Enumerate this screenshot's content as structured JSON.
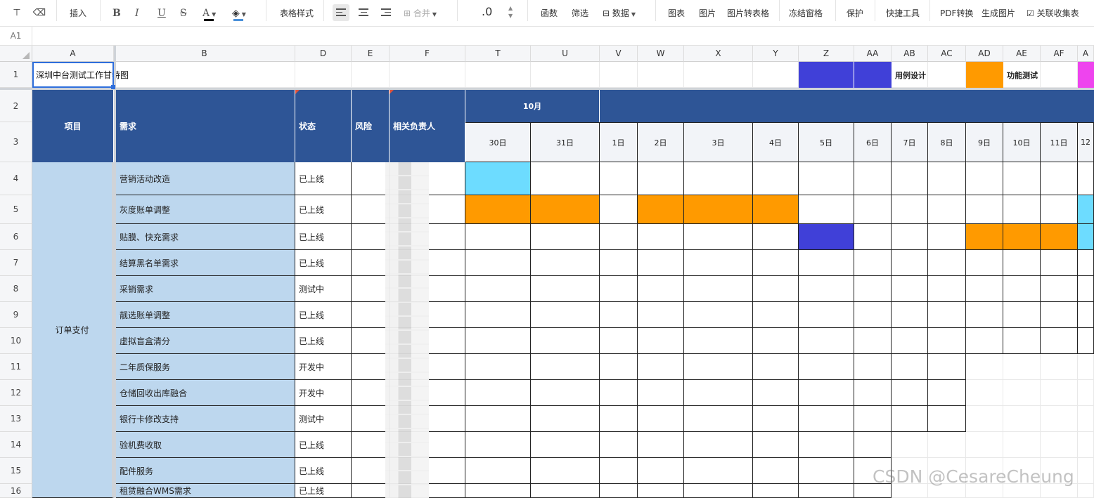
{
  "toolbar": {
    "insert": "插入",
    "table_style": "表格样式",
    "merge": "合并",
    "decimal": ".0",
    "function": "函数",
    "filter": "筛选",
    "data": "数据",
    "chart": "图表",
    "image": "图片",
    "image_to_table": "图片转表格",
    "freeze": "冻结窗格",
    "protect": "保护",
    "quick_tools": "快捷工具",
    "pdf_convert": "PDF转换",
    "generate_image": "生成图片",
    "linked_form": "关联收集表",
    "font_color": "#000000",
    "fill_color": "#4a90d9"
  },
  "formula": {
    "cell_ref": "A1"
  },
  "columns": [
    "A",
    "B",
    "D",
    "E",
    "F",
    "T",
    "U",
    "V",
    "W",
    "X",
    "Y",
    "Z",
    "AA",
    "AB",
    "AC",
    "AD",
    "AE",
    "AF",
    "A"
  ],
  "rows": [
    "1",
    "2",
    "3",
    "4",
    "5",
    "6",
    "7",
    "8",
    "9",
    "10",
    "11",
    "12",
    "13",
    "14",
    "15",
    "16"
  ],
  "title": "深圳中台测试工作甘特图",
  "legend": {
    "design_label": "用例设计",
    "func_test_label": "功能测试",
    "design_color": "#4040d8",
    "func_color": "#ff9a00",
    "other_color": "#ee44ee"
  },
  "header": {
    "project": "项目",
    "requirement": "需求",
    "status": "状态",
    "risk": "风险",
    "owner": "相关负责人",
    "month": "10月",
    "days": [
      "30日",
      "31日",
      "1日",
      "2日",
      "3日",
      "4日",
      "5日",
      "6日",
      "7日",
      "8日",
      "9日",
      "10日",
      "11日",
      "12"
    ]
  },
  "project_name": "订单支付",
  "tasks": [
    {
      "name": "营销活动改造",
      "status": "已上线"
    },
    {
      "name": "灰度账单调整",
      "status": "已上线"
    },
    {
      "name": "贴膜、快充需求",
      "status": "已上线"
    },
    {
      "name": "结算黑名单需求",
      "status": "已上线"
    },
    {
      "name": "采销需求",
      "status": "测试中"
    },
    {
      "name": "靓选账单调整",
      "status": "已上线"
    },
    {
      "name": "虚拟盲盒清分",
      "status": "已上线"
    },
    {
      "name": "二年质保服务",
      "status": "开发中"
    },
    {
      "name": "仓储回收出库融合",
      "status": "开发中"
    },
    {
      "name": "银行卡修改支持",
      "status": "测试中"
    },
    {
      "name": "验机费收取",
      "status": "已上线"
    },
    {
      "name": "配件服务",
      "status": "已上线"
    },
    {
      "name": "租赁融合WMS需求",
      "status": "已上线"
    }
  ],
  "colors": {
    "cyan": "#6ddcff",
    "orange": "#ff9a00",
    "blue": "#4040d8",
    "header_blue": "#2e5596",
    "req_blue": "#bdd7ee"
  },
  "watermark": "CSDN @CesareCheung"
}
